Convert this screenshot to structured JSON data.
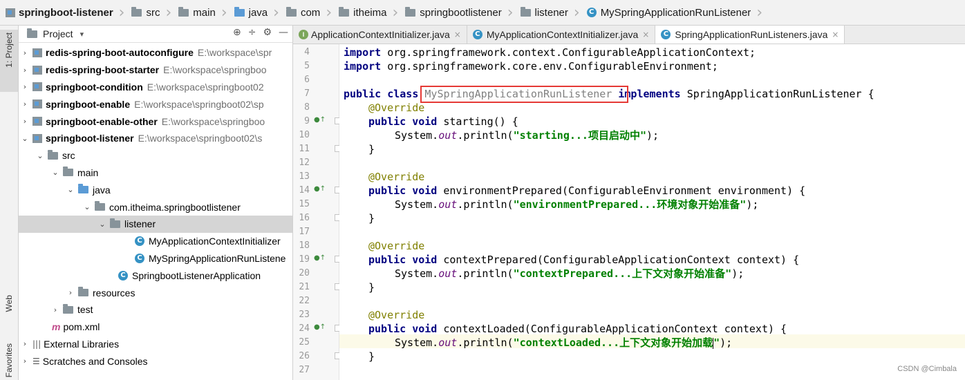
{
  "breadcrumb": [
    "springboot-listener",
    "src",
    "main",
    "java",
    "com",
    "itheima",
    "springbootlistener",
    "listener",
    "MySpringApplicationRunListener"
  ],
  "sidebar_stripe": {
    "project": "1: Project",
    "web": "Web",
    "favorites": "Favorites"
  },
  "panel": {
    "title": "Project",
    "dropdown": "▾",
    "tools": [
      "⊕",
      "÷",
      "⚙",
      "—"
    ]
  },
  "tree": [
    {
      "label": "redis-spring-boot-autoconfigure",
      "path": "E:\\workspace\\spr"
    },
    {
      "label": "redis-spring-boot-starter",
      "path": "E:\\workspace\\springboo"
    },
    {
      "label": "springboot-condition",
      "path": "E:\\workspace\\springboot02"
    },
    {
      "label": "springboot-enable",
      "path": "E:\\workspace\\springboot02\\sp"
    },
    {
      "label": "springboot-enable-other",
      "path": "E:\\workspace\\springboo"
    },
    {
      "label": "springboot-listener",
      "path": "E:\\workspace\\springboot02\\s"
    },
    {
      "label": "src"
    },
    {
      "label": "main"
    },
    {
      "label": "java"
    },
    {
      "label": "com.itheima.springbootlistener"
    },
    {
      "label": "listener"
    },
    {
      "label": "MyApplicationContextInitializer"
    },
    {
      "label": "MySpringApplicationRunListene"
    },
    {
      "label": "SpringbootListenerApplication"
    },
    {
      "label": "resources"
    },
    {
      "label": "test"
    },
    {
      "label": "pom.xml"
    },
    {
      "label": "External Libraries"
    },
    {
      "label": "Scratches and Consoles"
    }
  ],
  "tabs": [
    {
      "label": "ApplicationContextInitializer.java",
      "icon": "I"
    },
    {
      "label": "MyApplicationContextInitializer.java",
      "icon": "C"
    },
    {
      "label": "SpringApplicationRunListeners.java",
      "icon": "C"
    }
  ],
  "code": {
    "line_numbers": [
      "4",
      "5",
      "6",
      "7",
      "8",
      "9",
      "10",
      "11",
      "12",
      "13",
      "14",
      "15",
      "16",
      "17",
      "18",
      "19",
      "20",
      "21",
      "22",
      "23",
      "24",
      "25",
      "26",
      "27"
    ],
    "l4_kw": "import",
    "l4_rest": " org.springframework.context.ConfigurableApplicationContext;",
    "l5_kw": "import",
    "l5_rest": " org.springframework.core.env.ConfigurableEnvironment;",
    "l7_kw": "public class",
    "l7_class": "MySpringApplicationRunListener",
    "l7_impl": "implements",
    "l7_rest": " SpringApplicationRunListener {",
    "override": "@Override",
    "pv": "public void",
    "sys": "System.",
    "out": "out",
    "println": ".println(",
    "close": "}",
    "m1_sig": " starting() {",
    "m1_str": "\"starting...项目启动中\"",
    "m1_end": ");",
    "m2_sig": " environmentPrepared(ConfigurableEnvironment environment) {",
    "m2_str": "\"environmentPrepared...环境对象开始准备\"",
    "m2_end": ");",
    "m3_sig": " contextPrepared(ConfigurableApplicationContext context) {",
    "m3_str": "\"contextPrepared...上下文对象开始准备\"",
    "m3_end": ");",
    "m4_sig": " contextLoaded(ConfigurableApplicationContext context) {",
    "m4_str_a": "\"contextLoaded...上下文对象开始加载",
    "m4_str_b": "\"",
    "m4_end": ");"
  },
  "watermark": "CSDN @Cimbala",
  "colors": {
    "keyword": "#000080",
    "annotation": "#808000",
    "string": "#008000",
    "field": "#660e7a",
    "highlight_box": "#e53935"
  }
}
